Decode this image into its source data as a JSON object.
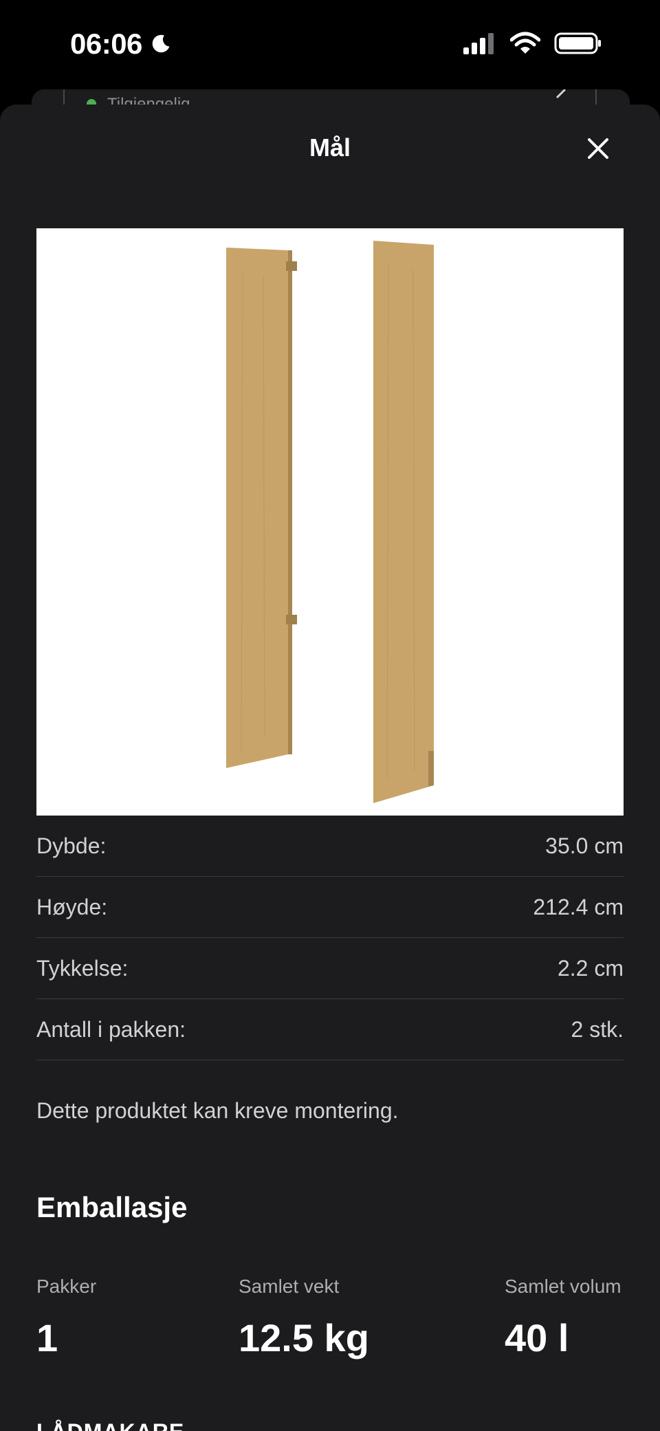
{
  "status_bar": {
    "time": "06:06"
  },
  "background_card": {
    "availability": "Tilgjengelig"
  },
  "sheet": {
    "title": "Mål"
  },
  "dimensions": [
    {
      "label": "Dybde:",
      "value": "35.0 cm"
    },
    {
      "label": "Høyde:",
      "value": "212.4 cm"
    },
    {
      "label": "Tykkelse:",
      "value": "2.2 cm"
    },
    {
      "label": "Antall i pakken:",
      "value": "2 stk."
    }
  ],
  "assembly_note": "Dette produktet kan kreve montering.",
  "packaging": {
    "heading": "Emballasje",
    "packages_label": "Pakker",
    "packages_value": "1",
    "weight_label": "Samlet vekt",
    "weight_value": "12.5 kg",
    "volume_label": "Samlet volum",
    "volume_value": "40 l"
  },
  "next_section": {
    "heading": "LÅDMAKARE"
  },
  "colors": {
    "sheet_bg": "#1c1c1e",
    "divider": "#3a3a3c",
    "available": "#4caf50",
    "wood": "#c9a46a"
  }
}
